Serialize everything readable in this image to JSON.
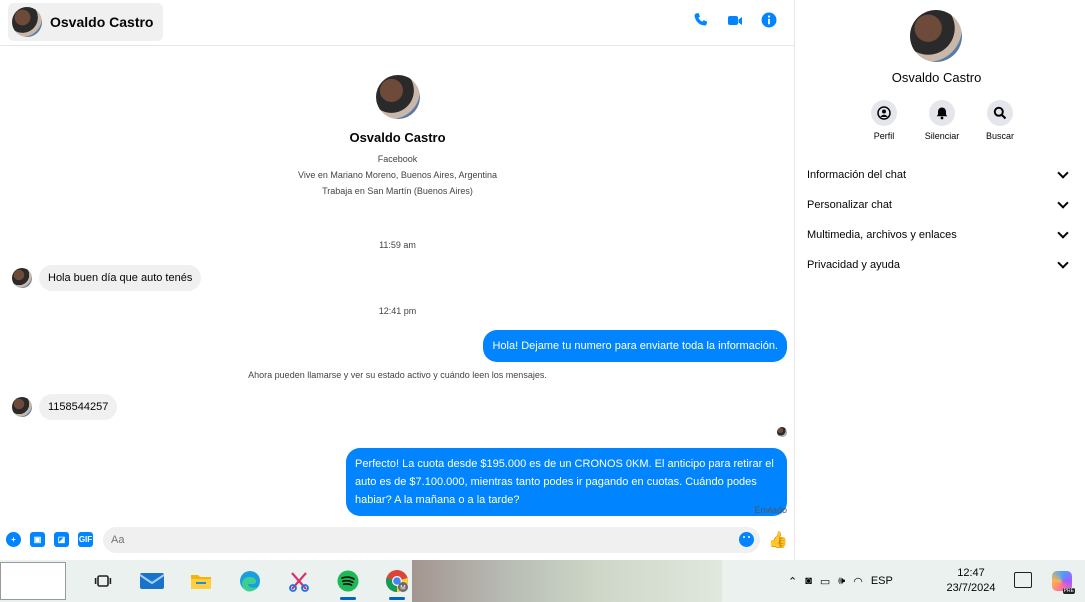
{
  "header": {
    "contact_name": "Osvaldo Castro",
    "icons": [
      "phone-icon",
      "video-icon",
      "info-icon"
    ]
  },
  "profile": {
    "name": "Osvaldo Castro",
    "source": "Facebook",
    "lives": "Vive en Mariano Moreno, Buenos Aires, Argentina",
    "works": "Trabaja en San Martín (Buenos Aires)"
  },
  "messages": {
    "time1": "11:59 am",
    "in1": "Hola buen día que auto tenés",
    "time2": "12:41 pm",
    "out1": "Hola! Dejame tu numero  para enviarte toda la información.",
    "system": "Ahora pueden llamarse y ver su estado activo y cuándo leen los mensajes.",
    "in2": "1158544257",
    "out2": "Perfecto! La cuota desde $195.000 es de un CRONOS 0KM. El anticipo para retirar el auto es de $7.100.000, mientras tanto podes ir pagando en cuotas. Cuándo podes habiar? A la mañana o a la tarde?",
    "status": "Enviado"
  },
  "composer": {
    "placeholder": "Aa",
    "gif_label": "GIF"
  },
  "info_panel": {
    "name": "Osvaldo Castro",
    "actions": [
      {
        "label": "Perfil",
        "icon": "profile-icon"
      },
      {
        "label": "Silenciar",
        "icon": "bell-icon"
      },
      {
        "label": "Buscar",
        "icon": "search-icon"
      }
    ],
    "sections": [
      {
        "label": "Información del chat"
      },
      {
        "label": "Personalizar chat"
      },
      {
        "label": "Multimedia, archivos y enlaces"
      },
      {
        "label": "Privacidad y ayuda"
      }
    ]
  },
  "taskbar": {
    "apps": [
      "task-view-icon",
      "mail-icon",
      "file-explorer-icon",
      "edge-icon",
      "snipping-tool-icon",
      "spotify-icon",
      "chrome-icon"
    ],
    "language": "ESP",
    "time": "12:47",
    "date": "23/7/2024",
    "copilot_badge": "PRE"
  },
  "colors": {
    "accent": "#0084ff",
    "bubble_in": "#f0f0f0",
    "taskbar": "#eaf1ee"
  }
}
